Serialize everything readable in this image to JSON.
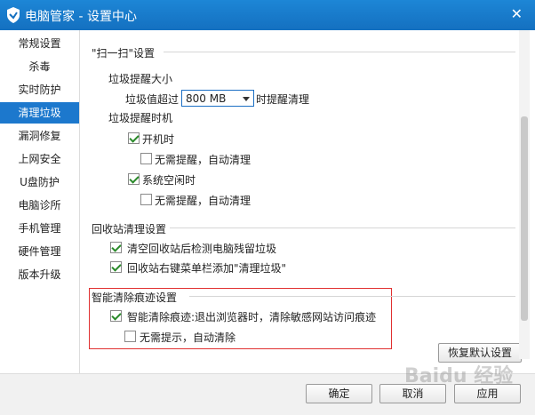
{
  "window": {
    "title": "电脑管家 - 设置中心",
    "close_label": "✕"
  },
  "sidebar": {
    "items": [
      {
        "label": "常规设置"
      },
      {
        "label": "杀毒"
      },
      {
        "label": "实时防护"
      },
      {
        "label": "清理垃圾",
        "active": true
      },
      {
        "label": "漏洞修复"
      },
      {
        "label": "上网安全"
      },
      {
        "label": "U盘防护"
      },
      {
        "label": "电脑诊所"
      },
      {
        "label": "手机管理"
      },
      {
        "label": "硬件管理"
      },
      {
        "label": "版本升级"
      }
    ]
  },
  "scan": {
    "section_title": "\"扫一扫\"设置",
    "reminder_size_title": "垃圾提醒大小",
    "threshold_prefix": "垃圾值超过",
    "threshold_value": "800 MB",
    "threshold_suffix": "时提醒清理",
    "reminder_time_title": "垃圾提醒时机",
    "boot_label": "开机时",
    "boot_checked": true,
    "boot_auto_label": "无需提醒，自动清理",
    "boot_auto_checked": false,
    "idle_label": "系统空闲时",
    "idle_checked": true,
    "idle_auto_label": "无需提醒，自动清理",
    "idle_auto_checked": false
  },
  "recycle": {
    "section_title": "回收站清理设置",
    "opt1_label": "清空回收站后检测电脑残留垃圾",
    "opt1_checked": true,
    "opt2_label": "回收站右键菜单栏添加\"清理垃圾\"",
    "opt2_checked": true
  },
  "traces": {
    "section_title": "智能清除痕迹设置",
    "opt1_label": "智能清除痕迹:退出浏览器时，清除敏感网站访问痕迹",
    "opt1_checked": true,
    "opt2_label": "无需提示，自动清除",
    "opt2_checked": false
  },
  "buttons": {
    "restore": "恢复默认设置",
    "ok": "确定",
    "cancel": "取消",
    "apply": "应用"
  },
  "watermark": "Baidu 经验",
  "colors": {
    "titlebar": "#1470c0",
    "active": "#1c78cd",
    "highlight_border": "#e03030"
  }
}
